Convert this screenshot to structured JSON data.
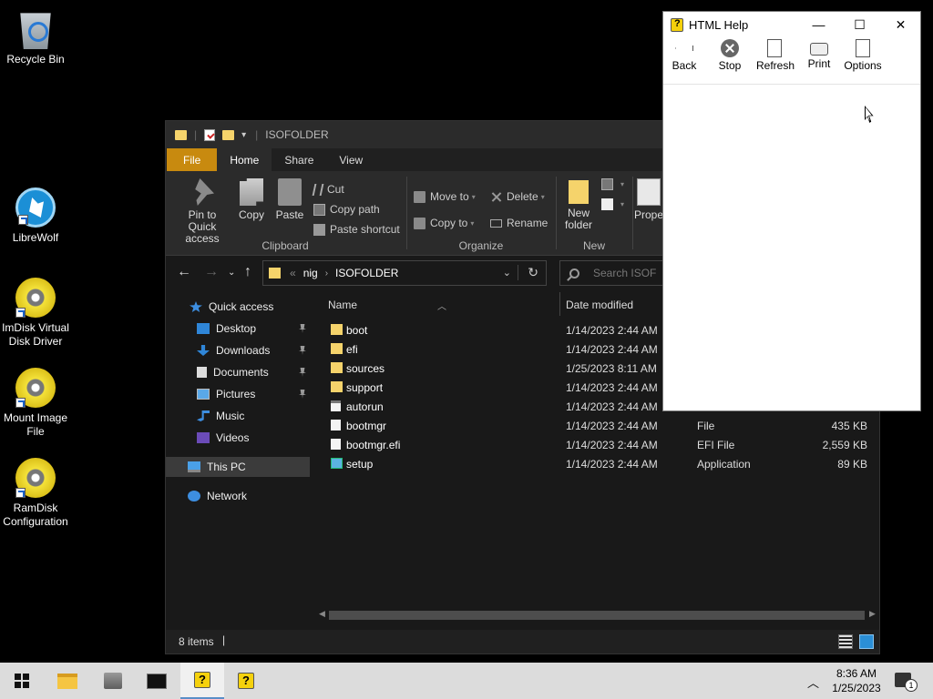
{
  "desktop": {
    "icons": [
      {
        "label_line1": "Recycle Bin",
        "label_line2": ""
      },
      {
        "label_line1": "LibreWolf",
        "label_line2": ""
      },
      {
        "label_line1": "ImDisk Virtual",
        "label_line2": "Disk Driver"
      },
      {
        "label_line1": "Mount Image",
        "label_line2": "File"
      },
      {
        "label_line1": "RamDisk",
        "label_line2": "Configuration"
      }
    ]
  },
  "explorer": {
    "title": "ISOFOLDER",
    "tabs": {
      "file": "File",
      "home": "Home",
      "share": "Share",
      "view": "View"
    },
    "ribbon": {
      "clipboard": {
        "label": "Clipboard",
        "pin_line1": "Pin to Quick",
        "pin_line2": "access",
        "copy": "Copy",
        "paste": "Paste",
        "cut": "Cut",
        "copy_path": "Copy path",
        "paste_shortcut": "Paste shortcut"
      },
      "organize": {
        "label": "Organize",
        "move_to": "Move to",
        "copy_to": "Copy to",
        "delete": "Delete",
        "rename": "Rename"
      },
      "new": {
        "label": "New",
        "folder_line1": "New",
        "folder_line2": "folder"
      },
      "open": {
        "properties": "Prope"
      }
    },
    "address": {
      "overflow": "«",
      "crumbs": [
        "nig",
        "ISOFOLDER"
      ]
    },
    "search": {
      "placeholder": "Search ISOF"
    },
    "sidebar": {
      "quick_access": "Quick access",
      "items": [
        "Desktop",
        "Downloads",
        "Documents",
        "Pictures",
        "Music",
        "Videos"
      ],
      "this_pc": "This PC",
      "network": "Network"
    },
    "columns": {
      "name": "Name",
      "date_modified": "Date modified"
    },
    "files": [
      {
        "name": "boot",
        "date": "1/14/2023 2:44 AM",
        "type": "",
        "size": "",
        "kind": "folder"
      },
      {
        "name": "efi",
        "date": "1/14/2023 2:44 AM",
        "type": "",
        "size": "",
        "kind": "folder"
      },
      {
        "name": "sources",
        "date": "1/25/2023 8:11 AM",
        "type": "",
        "size": "",
        "kind": "folder"
      },
      {
        "name": "support",
        "date": "1/14/2023 2:44 AM",
        "type": "",
        "size": "",
        "kind": "folder"
      },
      {
        "name": "autorun",
        "date": "1/14/2023 2:44 AM",
        "type": "",
        "size": "",
        "kind": "autorun"
      },
      {
        "name": "bootmgr",
        "date": "1/14/2023 2:44 AM",
        "type": "File",
        "size": "435 KB",
        "kind": "file"
      },
      {
        "name": "bootmgr.efi",
        "date": "1/14/2023 2:44 AM",
        "type": "EFI File",
        "size": "2,559 KB",
        "kind": "file"
      },
      {
        "name": "setup",
        "date": "1/14/2023 2:44 AM",
        "type": "Application",
        "size": "89 KB",
        "kind": "setup"
      }
    ],
    "status": {
      "item_count": "8 items"
    }
  },
  "help_window": {
    "title": "HTML Help",
    "toolbar": {
      "back": "Back",
      "stop": "Stop",
      "refresh": "Refresh",
      "print": "Print",
      "options": "Options"
    }
  },
  "taskbar": {
    "time": "8:36 AM",
    "date": "1/25/2023",
    "notification_count": "1"
  },
  "colors": {
    "accent_file_tab": "#c88a0f",
    "folder": "#f5d36b",
    "selection": "#3b3b3b"
  }
}
